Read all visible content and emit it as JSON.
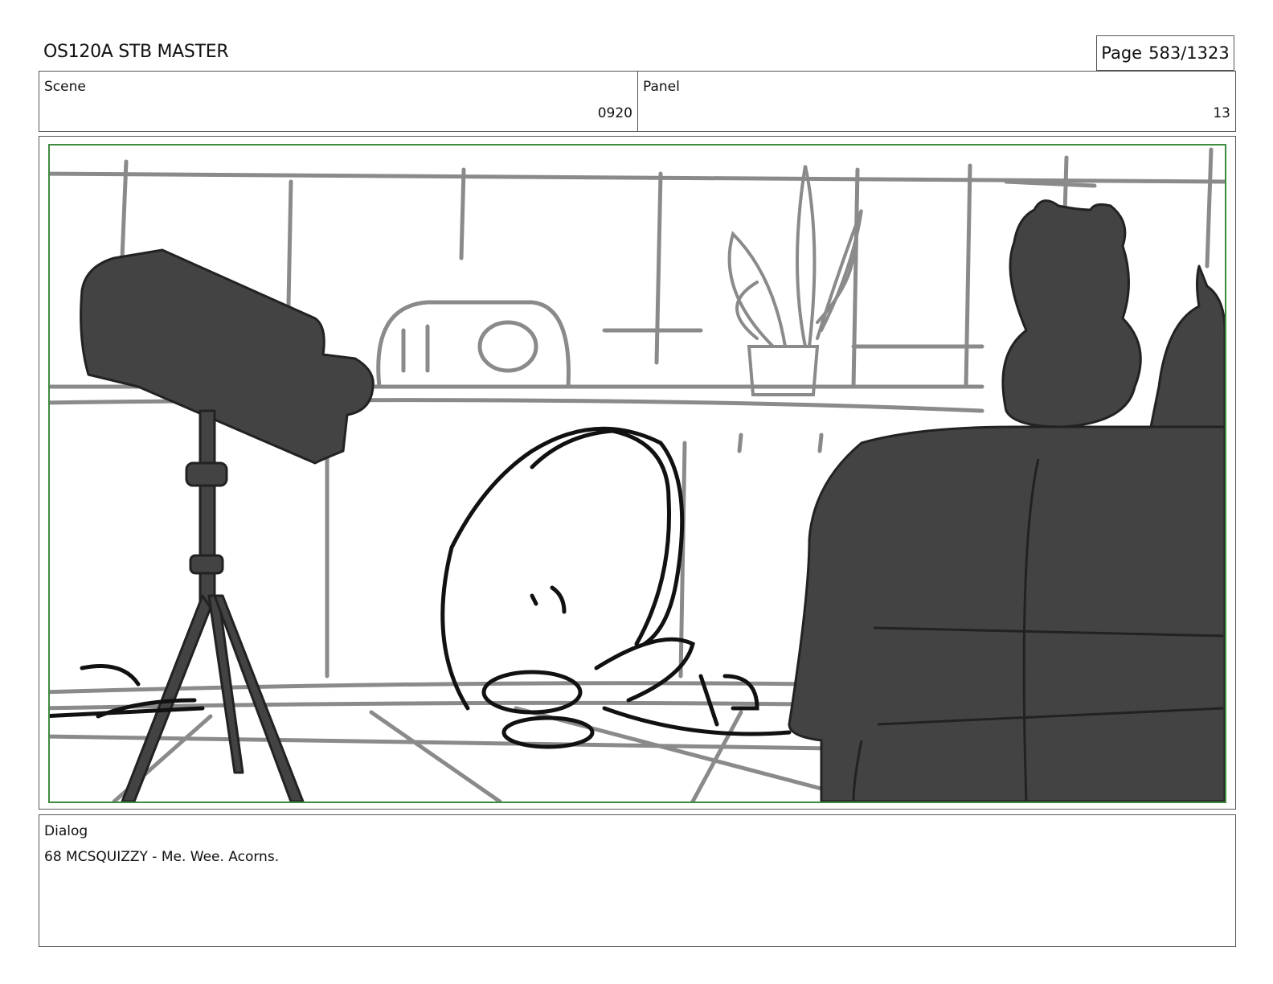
{
  "header": {
    "title": "OS120A STB MASTER",
    "page_label": "Page",
    "page_value": "583/1323"
  },
  "scene": {
    "label": "Scene",
    "value": "0920"
  },
  "panel": {
    "label": "Panel",
    "value": "13"
  },
  "frame": {
    "border_color": "#3f8a3f",
    "fill_dark": "#434343",
    "line_gray": "#8a8a8a"
  },
  "dialog": {
    "label": "Dialog",
    "text": "68 MCSQUIZZY - Me. Wee. Acorns."
  }
}
